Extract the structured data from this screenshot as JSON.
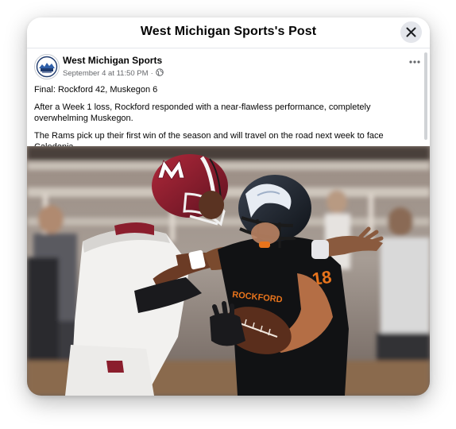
{
  "modal": {
    "title": "West Michigan Sports's Post"
  },
  "post": {
    "author": "West Michigan Sports",
    "timestamp": "September 4 at 11:50 PM",
    "separator": "·",
    "privacy_icon": "globe-icon",
    "more_icon": "more-options-icon",
    "paragraphs": [
      "Final: Rockford 42, Muskegon 6",
      "After a Week 1 loss, Rockford responded with a near-flawless performance, completely overwhelming Muskegon.",
      "The Rams pick up their first win of the season and will travel on the road next week to face Caledonia."
    ]
  },
  "photo": {
    "jersey_text": "ROCKFORD",
    "jersey_number": "18"
  },
  "colors": {
    "close_button_bg": "#e4e6eb",
    "text_primary": "#050505",
    "text_secondary": "#65676b",
    "muskegon_maroon": "#8b1e2d",
    "rockford_orange": "#e8741c"
  }
}
